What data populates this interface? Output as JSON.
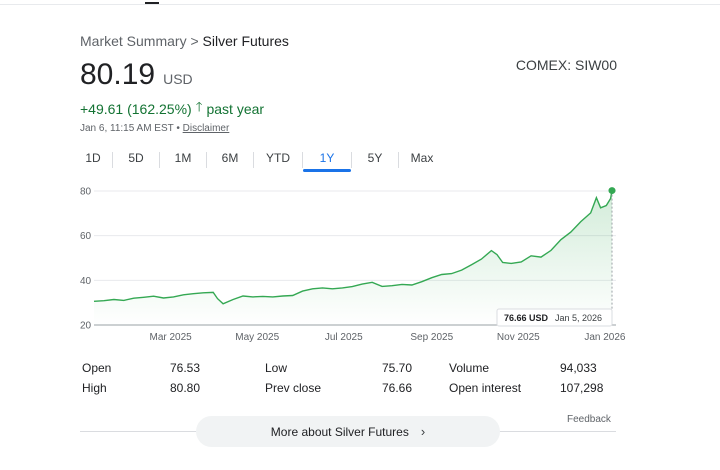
{
  "breadcrumb": {
    "parent": "Market Summary",
    "separator": " > ",
    "current": "Silver Futures"
  },
  "quote": {
    "price": "80.19",
    "currency": "USD",
    "exchange": "COMEX: SIW00",
    "change": "+49.61 (162.25%)",
    "change_icon": "arrow-up-icon",
    "change_period": "past year",
    "timestamp": "Jan 6, 11:15 AM EST",
    "timestamp_sep": " • ",
    "disclaimer": "Disclaimer"
  },
  "colors": {
    "accent": "#1a73e8",
    "positive": "#137333",
    "line": "#34a853"
  },
  "tabs": [
    {
      "label": "1D",
      "active": false
    },
    {
      "label": "5D",
      "active": false
    },
    {
      "label": "1M",
      "active": false
    },
    {
      "label": "6M",
      "active": false
    },
    {
      "label": "YTD",
      "active": false
    },
    {
      "label": "1Y",
      "active": true
    },
    {
      "label": "5Y",
      "active": false
    },
    {
      "label": "Max",
      "active": false
    }
  ],
  "chart_data": {
    "type": "area",
    "x_ticks": [
      "Mar 2025",
      "May 2025",
      "Jul 2025",
      "Sep 2025",
      "Nov 2025",
      "Jan 2026"
    ],
    "y_ticks": [
      20,
      40,
      60,
      80
    ],
    "ylim": [
      20,
      80
    ],
    "xlim": [
      "2025-01-06",
      "2026-01-06"
    ],
    "grid": "horizontal",
    "hover": {
      "value": "76.66 USD",
      "date": "Jan 5, 2026"
    },
    "series": [
      {
        "x": [
          "2025-01-06",
          "2025-01-13",
          "2025-01-20",
          "2025-01-27",
          "2025-02-03",
          "2025-02-10",
          "2025-02-17",
          "2025-02-24",
          "2025-03-03",
          "2025-03-10",
          "2025-03-17",
          "2025-03-24",
          "2025-03-31",
          "2025-04-03",
          "2025-04-07",
          "2025-04-14",
          "2025-04-21",
          "2025-04-28",
          "2025-05-05",
          "2025-05-12",
          "2025-05-19",
          "2025-05-26",
          "2025-06-02",
          "2025-06-09",
          "2025-06-16",
          "2025-06-23",
          "2025-06-30",
          "2025-07-07",
          "2025-07-14",
          "2025-07-21",
          "2025-07-28",
          "2025-08-04",
          "2025-08-11",
          "2025-08-18",
          "2025-08-25",
          "2025-09-01",
          "2025-09-08",
          "2025-09-15",
          "2025-09-22",
          "2025-09-29",
          "2025-10-06",
          "2025-10-13",
          "2025-10-17",
          "2025-10-21",
          "2025-10-27",
          "2025-11-03",
          "2025-11-10",
          "2025-11-17",
          "2025-11-24",
          "2025-12-01",
          "2025-12-08",
          "2025-12-15",
          "2025-12-22",
          "2025-12-26",
          "2025-12-29",
          "2026-01-02",
          "2026-01-05",
          "2026-01-06"
        ],
        "values": [
          30.6,
          30.9,
          31.4,
          31.0,
          32.0,
          32.4,
          32.9,
          32.1,
          32.6,
          33.5,
          34.0,
          34.4,
          34.6,
          31.8,
          29.5,
          31.4,
          33.0,
          32.6,
          32.8,
          32.6,
          33.0,
          33.2,
          35.2,
          36.2,
          36.6,
          36.2,
          36.6,
          37.2,
          38.3,
          39.1,
          37.3,
          37.6,
          38.2,
          37.9,
          39.4,
          41.2,
          42.6,
          43.0,
          44.6,
          47.0,
          49.5,
          53.3,
          51.5,
          48.0,
          47.6,
          48.2,
          51.0,
          50.4,
          53.4,
          58.2,
          61.6,
          66.3,
          70.2,
          77.0,
          72.5,
          73.5,
          76.66,
          80.19
        ]
      }
    ]
  },
  "stats": [
    {
      "label": "Open",
      "value": "76.53"
    },
    {
      "label": "High",
      "value": "80.80"
    },
    {
      "label": "Low",
      "value": "75.70"
    },
    {
      "label": "Prev close",
      "value": "76.66"
    },
    {
      "label": "Volume",
      "value": "94,033"
    },
    {
      "label": "Open interest",
      "value": "107,298"
    }
  ],
  "feedback": "Feedback",
  "more_button": {
    "label": "More about Silver Futures",
    "icon": "chevron-right-icon"
  }
}
